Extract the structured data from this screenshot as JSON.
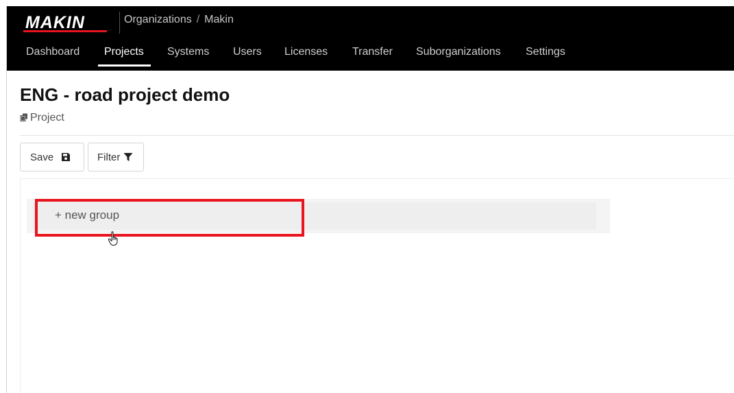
{
  "app": {
    "logo_text": "MAKIN",
    "breadcrumb": [
      "Organizations",
      "Makin"
    ],
    "breadcrumb_separator": "/"
  },
  "nav": {
    "tabs": [
      {
        "label": "Dashboard",
        "active": false
      },
      {
        "label": "Projects",
        "active": true
      },
      {
        "label": "Systems",
        "active": false
      },
      {
        "label": "Users",
        "active": false
      },
      {
        "label": "Licenses",
        "active": false
      },
      {
        "label": "Transfer",
        "active": false
      },
      {
        "label": "Suborganizations",
        "active": false
      },
      {
        "label": "Settings",
        "active": false
      }
    ]
  },
  "page": {
    "title": "ENG - road project demo",
    "type_label": "Project",
    "type_icon": "copy-icon"
  },
  "toolbar": {
    "save_label": "Save",
    "save_icon": "floppy-disk-icon",
    "filter_label": "Filter",
    "filter_icon": "funnel-icon"
  },
  "groups": {
    "new_group_label": "+ new group"
  },
  "colors": {
    "topbar_bg": "#000000",
    "highlight_border": "#e8141e",
    "group_bg": "#eeeeee"
  },
  "annotations": {
    "highlight": "red rectangle around new group button",
    "cursor": "hand-pointer-icon"
  }
}
